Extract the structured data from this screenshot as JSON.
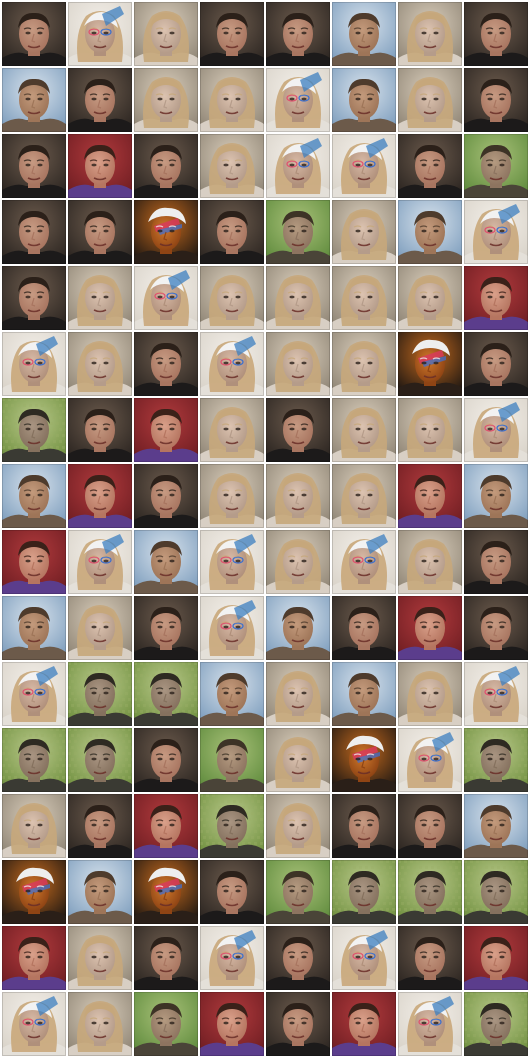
{
  "grid": {
    "columns": 8,
    "rows": 16,
    "tiles": [
      [
        "A",
        "C",
        "B",
        "A",
        "A",
        "D",
        "B",
        "A"
      ],
      [
        "D",
        "A",
        "B",
        "B",
        "C",
        "D",
        "B",
        "A"
      ],
      [
        "A",
        "F",
        "A",
        "B",
        "C",
        "C",
        "A",
        "E"
      ],
      [
        "A",
        "A",
        "H",
        "A",
        "E",
        "B",
        "D",
        "C"
      ],
      [
        "A",
        "B",
        "C",
        "B",
        "B",
        "B",
        "B",
        "F"
      ],
      [
        "C",
        "B",
        "A",
        "C",
        "B",
        "B",
        "H",
        "A"
      ],
      [
        "G",
        "A",
        "F",
        "B",
        "A",
        "B",
        "B",
        "C"
      ],
      [
        "D",
        "F",
        "A",
        "B",
        "B",
        "B",
        "F",
        "D"
      ],
      [
        "F",
        "C",
        "D",
        "C",
        "B",
        "C",
        "B",
        "A"
      ],
      [
        "D",
        "B",
        "A",
        "C",
        "D",
        "A",
        "F",
        "A"
      ],
      [
        "C",
        "G",
        "G",
        "D",
        "B",
        "D",
        "B",
        "C"
      ],
      [
        "G",
        "G",
        "A",
        "E",
        "B",
        "H",
        "C",
        "G"
      ],
      [
        "B",
        "A",
        "F",
        "G",
        "B",
        "A",
        "A",
        "D"
      ],
      [
        "H",
        "D",
        "H",
        "A",
        "E",
        "G",
        "G",
        "G"
      ],
      [
        "F",
        "B",
        "A",
        "C",
        "A",
        "C",
        "A",
        "F"
      ],
      [
        "C",
        "B",
        "E",
        "F",
        "A",
        "F",
        "C",
        "G"
      ]
    ],
    "palettes": {
      "A": {
        "bg": "#2a2420",
        "bg2": "#6b5a4c",
        "skin": "#c69a82",
        "skin2": "#a87560",
        "hair": "#2b2019",
        "shirt": "#1c1a1a",
        "accent": "#6e5648"
      },
      "B": {
        "bg": "#8e8474",
        "bg2": "#d9cdbb",
        "skin": "#dcc3b0",
        "skin2": "#b59c8a",
        "hair": "#c6a77b",
        "shirt": "#d8cfc4",
        "accent": "#8da4c8"
      },
      "C": {
        "bg": "#d8d2c8",
        "bg2": "#f3efe9",
        "skin": "#d7b9a6",
        "skin2": "#b0907b",
        "hair": "#c9a77a",
        "shirt": "#e4e0d9",
        "accent": "#3c7fc0"
      },
      "D": {
        "bg": "#7c9cbc",
        "bg2": "#d7e2ec",
        "skin": "#c39a7c",
        "skin2": "#9e7558",
        "hair": "#4e3b2c",
        "shirt": "#6c5a4a",
        "accent": "#5d4c40"
      },
      "E": {
        "bg": "#5e8a3c",
        "bg2": "#a8c178",
        "skin": "#b49a80",
        "skin2": "#8d7460",
        "hair": "#3d3326",
        "shirt": "#4a4438",
        "accent": "#5f7a3f"
      },
      "F": {
        "bg": "#6e1d22",
        "bg2": "#b03a3c",
        "skin": "#d9a08a",
        "skin2": "#b57560",
        "hair": "#3a2119",
        "shirt": "#5b3d8c",
        "accent": "#d6c5df"
      },
      "G": {
        "bg": "#6f8f3e",
        "bg2": "#b9c98a",
        "skin": "#a99582",
        "skin2": "#85715e",
        "hair": "#2e2a22",
        "shirt": "#3a3a33",
        "accent": "#9ab066"
      },
      "H": {
        "bg": "#1a1512",
        "bg2": "#c46a1e",
        "skin": "#d0792c",
        "skin2": "#8f4414",
        "hair": "#eeeeee",
        "shirt": "#2a1f18",
        "accent": "#d83a5a"
      }
    }
  }
}
